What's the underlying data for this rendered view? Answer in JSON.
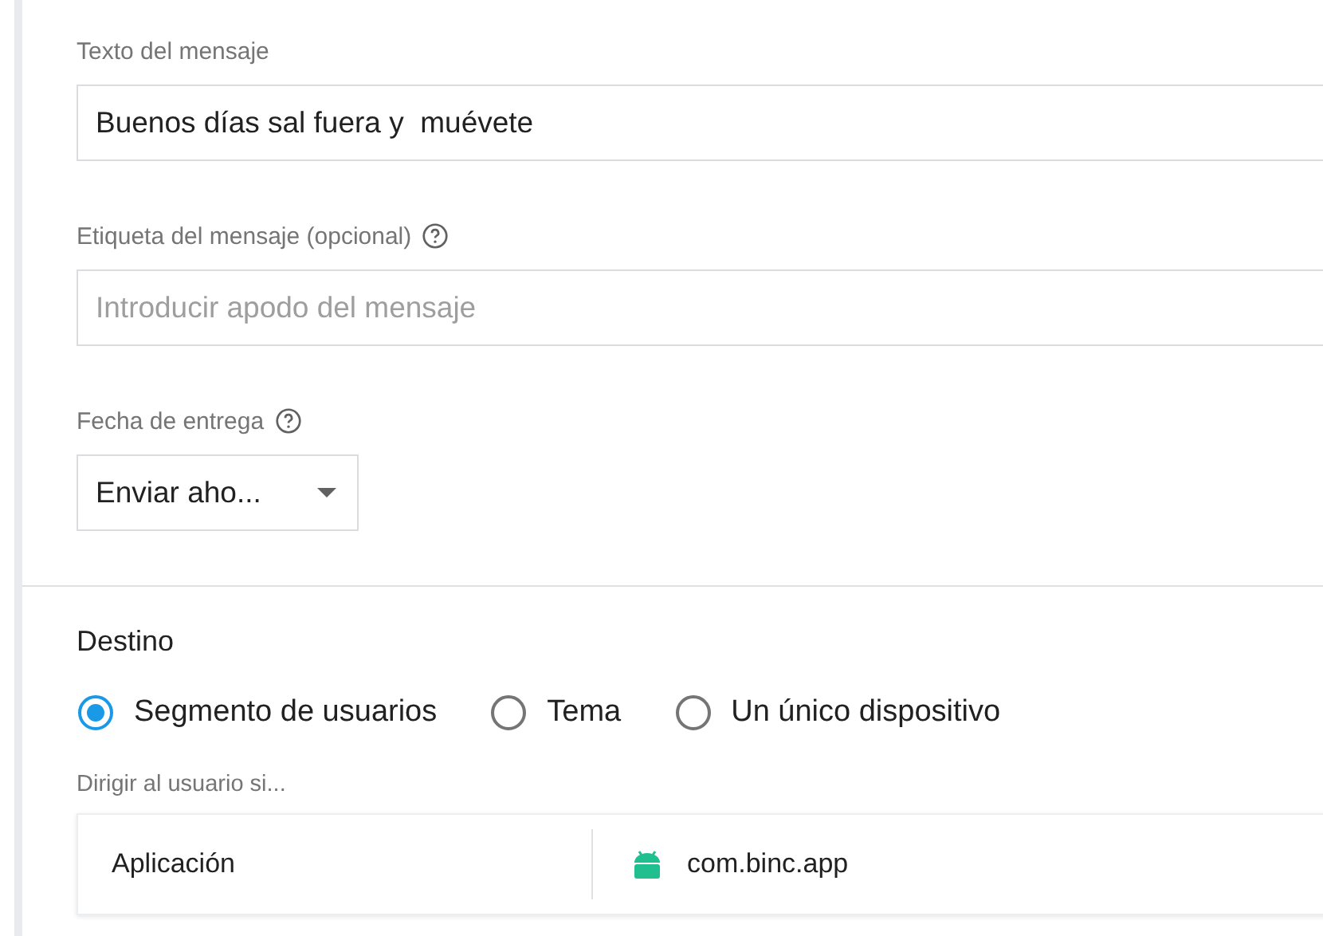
{
  "message_text": {
    "label": "Texto del mensaje",
    "value": "Buenos días sal fuera y  muévete"
  },
  "message_label": {
    "label": "Etiqueta del mensaje (opcional)",
    "placeholder": "Introducir apodo del mensaje"
  },
  "delivery_date": {
    "label": "Fecha de entrega",
    "value": "Enviar aho..."
  },
  "target": {
    "title": "Destino",
    "options": [
      {
        "label": "Segmento de usuarios",
        "selected": true
      },
      {
        "label": "Tema",
        "selected": false
      },
      {
        "label": "Un único dispositivo",
        "selected": false
      }
    ],
    "hint": "Dirigir al usuario si...",
    "rows": [
      {
        "column_1": "Aplicación",
        "column_2": "com.binc.app"
      }
    ]
  }
}
